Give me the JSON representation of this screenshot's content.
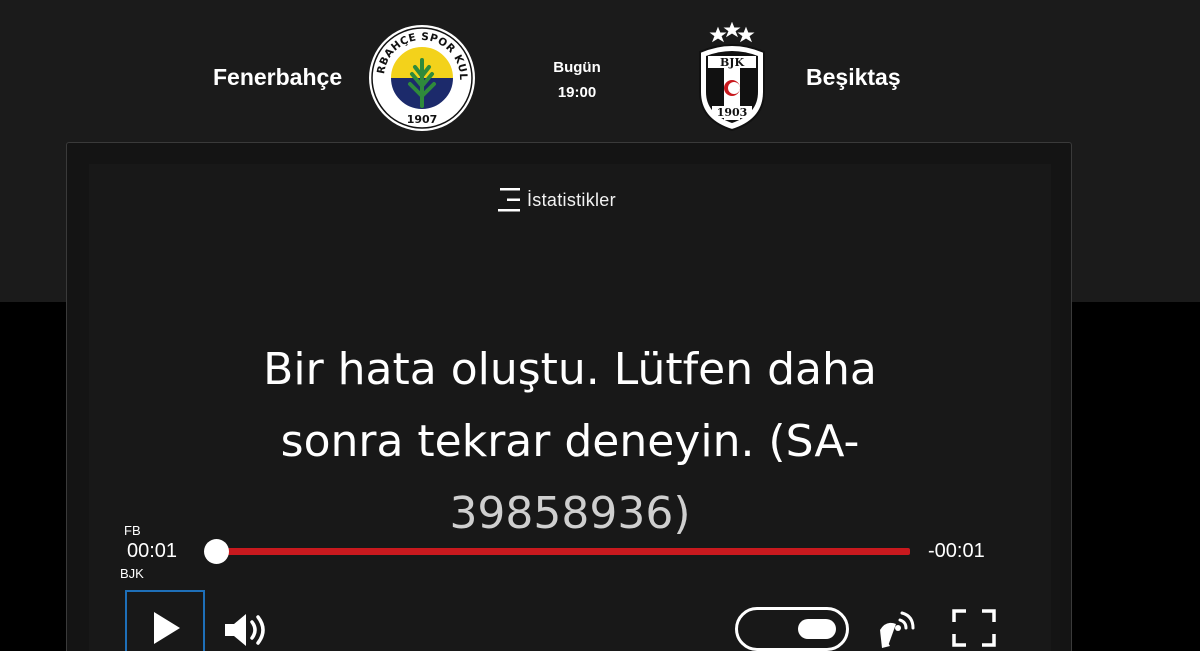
{
  "match": {
    "home_team": "Fenerbahçe",
    "away_team": "Beşiktaş",
    "day": "Bugün",
    "time": "19:00",
    "home_crest_text": "FENERBAHÇE SPOR KULÜBÜ",
    "home_crest_year": "1907",
    "away_crest_text": "BJK",
    "away_crest_year": "1903"
  },
  "player": {
    "stats_label": "İstatistikler",
    "error_line1": "Bir hata oluştu. Lütfen daha",
    "error_line2": "sonra tekrar deneyin. (SA-",
    "error_line3": "39858936)",
    "home_label": "FB",
    "away_label": "BJK",
    "time_current": "00:01",
    "time_remaining": "-00:01",
    "progress_fraction": 0.0
  },
  "icons": {
    "stats": "menu-lines-icon",
    "play": "play-icon",
    "volume": "volume-icon",
    "toggle": "toggle-icon",
    "cast": "cast-icon",
    "fullscreen": "fullscreen-icon"
  },
  "colors": {
    "header_bg": "#1b1b1b",
    "progress": "#c8191e",
    "focus_outline": "#1e6fb8"
  }
}
